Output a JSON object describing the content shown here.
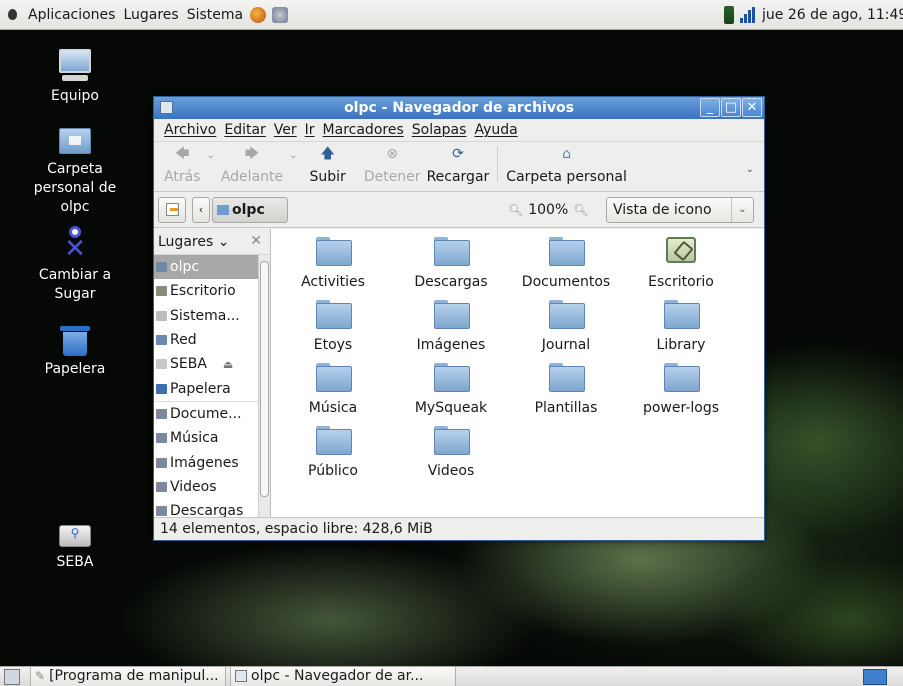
{
  "top_panel": {
    "menus": [
      "Aplicaciones",
      "Lugares",
      "Sistema"
    ],
    "clock": "jue 26 de ago, 11:49"
  },
  "desktop_icons": [
    {
      "label": "Equipo",
      "icon": "computer-icon"
    },
    {
      "label": "Carpeta personal de olpc",
      "icon": "home-folder-icon"
    },
    {
      "label": "Cambiar a Sugar",
      "icon": "sugar-xo-icon"
    },
    {
      "label": "Papelera",
      "icon": "trash-icon"
    },
    {
      "label": "SEBA",
      "icon": "usb-drive-icon"
    }
  ],
  "window": {
    "title": "olpc - Navegador de archivos",
    "menubar": [
      "Archivo",
      "Editar",
      "Ver",
      "Ir",
      "Marcadores",
      "Solapas",
      "Ayuda"
    ],
    "toolbar": {
      "back": "Atrás",
      "forward": "Adelante",
      "up": "Subir",
      "stop": "Detener",
      "reload": "Recargar",
      "home": "Carpeta personal"
    },
    "location": {
      "path_button": "olpc",
      "zoom": "100%",
      "view_mode": "Vista de icono"
    },
    "sidebar": {
      "header": "Lugares",
      "items": [
        {
          "label": "olpc",
          "selected": true
        },
        {
          "label": "Escritorio"
        },
        {
          "label": "Sistema..."
        },
        {
          "label": "Red"
        },
        {
          "label": "SEBA"
        },
        {
          "label": "Papelera"
        },
        {
          "label": "Docume..."
        },
        {
          "label": "Música"
        },
        {
          "label": "Imágenes"
        },
        {
          "label": "Videos"
        },
        {
          "label": "Descargas"
        }
      ]
    },
    "files": [
      "Activities",
      "Descargas",
      "Documentos",
      "Escritorio",
      "Etoys",
      "Imágenes",
      "Journal",
      "Library",
      "Música",
      "MySqueak",
      "Plantillas",
      "power-logs",
      "Público",
      "Videos"
    ],
    "status": "14 elementos, espacio libre: 428,6 MiB"
  },
  "bottom_panel": {
    "tasks": [
      "[Programa de manipul...",
      "olpc - Navegador de ar..."
    ]
  },
  "colors": {
    "titlebar": "#4a85cc",
    "selection": "#a8a8a8",
    "folder": "#9fc0e2"
  }
}
